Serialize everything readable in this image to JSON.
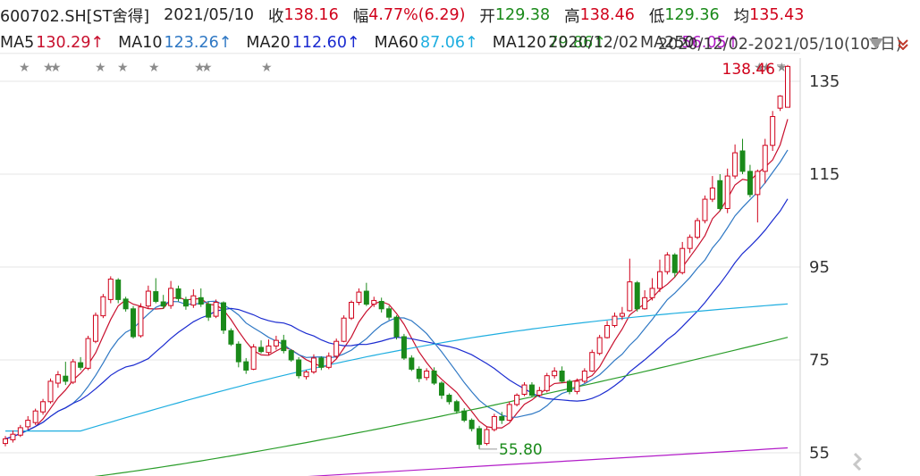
{
  "header": {
    "code": "600702.SH[ST舍得]",
    "date": "2021/05/10",
    "close_label": "收",
    "close": "138.16",
    "change_label": "幅",
    "change": "4.77%(6.29)",
    "open_label": "开",
    "open": "129.38",
    "high_label": "高",
    "high": "138.46",
    "low_label": "低",
    "low": "129.36",
    "avg_label": "均",
    "avg": "135.43"
  },
  "ma": [
    {
      "key": "ma5",
      "label": "MA5",
      "value": "130.29↑",
      "color": "#c8102e"
    },
    {
      "key": "ma10",
      "label": "MA10",
      "value": "123.26↑",
      "color": "#2f78c4"
    },
    {
      "key": "ma20",
      "label": "MA20",
      "value": "112.60↑",
      "color": "#1b2bd0"
    },
    {
      "key": "ma60",
      "label": "MA60",
      "value": "87.06↑",
      "color": "#1faee0"
    },
    {
      "key": "ma120",
      "label": "MA120",
      "value": "79.86↑",
      "color": "#2a9d2a"
    },
    {
      "key": "ma250",
      "label": "MA250",
      "value": "56.05↑",
      "color": "#b21cc8"
    }
  ],
  "range_text": "2020/12/02-2021/05/10(105日)",
  "overlay_date": "2020/12/02",
  "annotations": {
    "high_label": "138.46",
    "low_label": "55.80"
  },
  "colors": {
    "up": "#d0021b",
    "down": "#1a8a1a",
    "grid": "#e6e6e6",
    "axis_text": "#333333"
  },
  "chart_data": {
    "type": "candlestick",
    "yaxis": {
      "ticks": [
        55,
        75,
        95,
        115,
        135
      ],
      "range": [
        50,
        140
      ]
    },
    "high": 138.46,
    "low": 55.8,
    "candles": [
      [
        57.0,
        58.0,
        58.6,
        56.4
      ],
      [
        57.8,
        59.0,
        59.8,
        57.2
      ],
      [
        58.8,
        60.4,
        61.0,
        58.4
      ],
      [
        60.6,
        62.0,
        62.9,
        60.0
      ],
      [
        61.5,
        64.0,
        64.5,
        61.0
      ],
      [
        63.8,
        66.0,
        66.6,
        63.2
      ],
      [
        66.0,
        70.4,
        71.0,
        65.6
      ],
      [
        70.0,
        71.8,
        72.6,
        69.0
      ],
      [
        71.5,
        70.4,
        74.6,
        69.6
      ],
      [
        70.2,
        74.6,
        75.2,
        69.8
      ],
      [
        74.4,
        73.4,
        75.6,
        72.8
      ],
      [
        73.2,
        79.6,
        80.2,
        72.8
      ],
      [
        79.0,
        84.6,
        85.2,
        78.6
      ],
      [
        84.5,
        88.6,
        89.2,
        84.0
      ],
      [
        88.0,
        92.4,
        93.0,
        87.2
      ],
      [
        92.2,
        88.0,
        92.6,
        87.2
      ],
      [
        88.1,
        86.0,
        88.6,
        85.4
      ],
      [
        86.0,
        80.0,
        86.6,
        79.6
      ],
      [
        80.2,
        86.4,
        87.2,
        79.8
      ],
      [
        86.6,
        89.8,
        91.0,
        86.0
      ],
      [
        89.7,
        87.6,
        92.6,
        87.2
      ],
      [
        87.5,
        86.6,
        89.0,
        86.0
      ],
      [
        86.7,
        90.4,
        92.0,
        86.0
      ],
      [
        90.3,
        88.2,
        91.0,
        87.6
      ],
      [
        88.0,
        86.6,
        88.6,
        85.8
      ],
      [
        86.8,
        88.8,
        90.2,
        86.2
      ],
      [
        88.4,
        87.0,
        90.4,
        86.4
      ],
      [
        87.0,
        84.2,
        87.6,
        83.4
      ],
      [
        84.4,
        87.4,
        88.0,
        84.0
      ],
      [
        87.3,
        81.4,
        87.6,
        80.6
      ],
      [
        81.3,
        78.4,
        81.8,
        78.0
      ],
      [
        78.4,
        74.6,
        79.0,
        73.4
      ],
      [
        74.6,
        72.8,
        75.4,
        72.0
      ],
      [
        73.0,
        77.8,
        78.4,
        72.8
      ],
      [
        77.7,
        76.8,
        79.2,
        76.4
      ],
      [
        76.6,
        78.0,
        79.4,
        76.0
      ],
      [
        78.0,
        79.2,
        80.2,
        77.2
      ],
      [
        79.2,
        77.0,
        80.4,
        76.4
      ],
      [
        77.0,
        75.0,
        77.2,
        74.6
      ],
      [
        75.0,
        71.6,
        75.6,
        71.0
      ],
      [
        71.4,
        72.4,
        72.8,
        70.8
      ],
      [
        72.4,
        75.4,
        76.2,
        72.0
      ],
      [
        75.4,
        73.4,
        75.8,
        72.8
      ],
      [
        73.4,
        75.8,
        76.6,
        73.0
      ],
      [
        75.8,
        79.0,
        79.6,
        75.4
      ],
      [
        79.0,
        84.0,
        84.6,
        78.8
      ],
      [
        84.0,
        87.4,
        87.8,
        83.6
      ],
      [
        87.4,
        89.6,
        90.4,
        86.8
      ],
      [
        89.8,
        87.0,
        91.6,
        86.6
      ],
      [
        87.0,
        87.8,
        88.6,
        86.4
      ],
      [
        87.6,
        86.0,
        88.4,
        85.2
      ],
      [
        86.0,
        84.2,
        86.6,
        83.6
      ],
      [
        84.2,
        80.0,
        84.6,
        79.4
      ],
      [
        80.0,
        75.4,
        80.6,
        75.0
      ],
      [
        75.4,
        73.0,
        76.0,
        72.6
      ],
      [
        73.0,
        71.0,
        73.6,
        70.2
      ],
      [
        71.2,
        72.6,
        73.2,
        70.6
      ],
      [
        72.6,
        70.0,
        73.4,
        69.6
      ],
      [
        70.0,
        67.4,
        70.4,
        66.6
      ],
      [
        67.4,
        66.0,
        67.8,
        65.4
      ],
      [
        66.0,
        64.0,
        66.4,
        63.4
      ],
      [
        64.0,
        62.0,
        64.6,
        61.6
      ],
      [
        62.0,
        60.2,
        62.4,
        59.6
      ],
      [
        60.2,
        56.8,
        60.8,
        55.8
      ],
      [
        57.0,
        60.0,
        60.6,
        56.6
      ],
      [
        60.0,
        62.8,
        63.4,
        59.6
      ],
      [
        62.8,
        62.0,
        63.8,
        61.2
      ],
      [
        62.0,
        65.4,
        66.0,
        61.8
      ],
      [
        65.4,
        67.4,
        67.8,
        65.0
      ],
      [
        67.6,
        69.6,
        70.2,
        67.2
      ],
      [
        69.6,
        67.4,
        70.2,
        67.0
      ],
      [
        67.4,
        68.4,
        69.2,
        67.0
      ],
      [
        68.4,
        71.6,
        72.2,
        68.0
      ],
      [
        71.6,
        72.6,
        73.4,
        71.0
      ],
      [
        72.6,
        70.4,
        73.6,
        70.0
      ],
      [
        70.4,
        68.2,
        70.8,
        67.6
      ],
      [
        68.2,
        70.4,
        71.0,
        67.6
      ],
      [
        70.4,
        72.6,
        73.2,
        70.0
      ],
      [
        72.6,
        76.6,
        77.2,
        72.4
      ],
      [
        76.4,
        79.8,
        80.4,
        76.0
      ],
      [
        79.8,
        82.4,
        83.4,
        79.6
      ],
      [
        82.4,
        84.4,
        85.2,
        82.0
      ],
      [
        84.4,
        85.0,
        86.4,
        83.6
      ],
      [
        85.6,
        91.8,
        96.8,
        85.4
      ],
      [
        91.6,
        86.0,
        92.0,
        85.4
      ],
      [
        86.0,
        88.4,
        90.0,
        85.8
      ],
      [
        88.4,
        90.4,
        92.6,
        87.8
      ],
      [
        90.4,
        94.0,
        96.6,
        89.6
      ],
      [
        94.0,
        97.6,
        98.2,
        93.4
      ],
      [
        97.6,
        93.8,
        98.0,
        92.8
      ],
      [
        93.8,
        99.0,
        100.4,
        93.4
      ],
      [
        99.0,
        101.4,
        102.0,
        98.0
      ],
      [
        101.4,
        105.0,
        105.6,
        101.0
      ],
      [
        105.0,
        109.6,
        110.4,
        104.4
      ],
      [
        109.6,
        112.0,
        114.6,
        109.0
      ],
      [
        113.6,
        107.6,
        115.0,
        107.0
      ],
      [
        107.6,
        114.6,
        116.2,
        106.6
      ],
      [
        114.6,
        119.6,
        121.4,
        114.0
      ],
      [
        120.0,
        115.6,
        122.6,
        115.0
      ],
      [
        115.6,
        110.6,
        117.0,
        110.0
      ],
      [
        110.6,
        115.6,
        116.0,
        104.6
      ],
      [
        115.6,
        121.2,
        122.6,
        113.0
      ],
      [
        121.2,
        127.4,
        128.6,
        120.0
      ],
      [
        129.2,
        131.8,
        132.0,
        128.6
      ],
      [
        129.4,
        138.2,
        138.5,
        129.4
      ]
    ]
  }
}
